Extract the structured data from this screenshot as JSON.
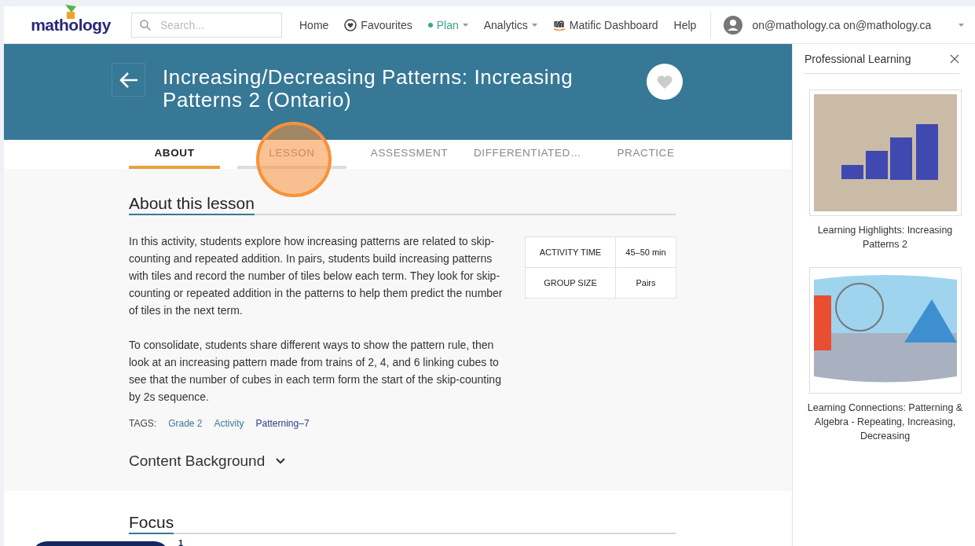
{
  "logo": {
    "text": "mathology"
  },
  "search": {
    "placeholder": "Search..."
  },
  "nav": [
    {
      "label": "Home",
      "kind": "plain",
      "selected": false
    },
    {
      "label": "Favourites",
      "kind": "favourites",
      "selected": false
    },
    {
      "label": "Plan",
      "kind": "dropdown",
      "selected": true
    },
    {
      "label": "Analytics",
      "kind": "dropdown",
      "selected": false
    },
    {
      "label": "Matific Dashboard",
      "kind": "matific",
      "selected": false
    },
    {
      "label": "Help",
      "kind": "plain",
      "selected": false
    }
  ],
  "user": {
    "email": "on@mathology.ca on@mathology.ca"
  },
  "lesson": {
    "title": "Increasing/Decreasing Patterns: Increasing Patterns 2 (Ontario)"
  },
  "tabs": [
    {
      "label": "ABOUT",
      "selected": true,
      "spotlight": false
    },
    {
      "label": "LESSON",
      "selected": false,
      "spotlight": true
    },
    {
      "label": "ASSESSMENT",
      "selected": false,
      "spotlight": false
    },
    {
      "label": "DIFFERENTIATED…",
      "selected": false,
      "spotlight": false
    },
    {
      "label": "PRACTICE",
      "selected": false,
      "spotlight": false
    }
  ],
  "about": {
    "heading": "About this lesson",
    "paragraphs": [
      "In this activity, students explore how increasing patterns are related to skip-counting and repeated addition. In pairs, students build increasing patterns with tiles and record the number of tiles below each term. They look for skip-counting or repeated addition in the patterns to help them predict the number of tiles in the next term.",
      "To consolidate, students share different ways to show the pattern rule, then look at an increasing pattern made from trains of 2, 4, and 6 linking cubes to see that the number of cubes in each term form the start of the skip-counting by 2s sequence."
    ],
    "facts": [
      {
        "label": "ACTIVITY TIME",
        "value": "45–50 min"
      },
      {
        "label": "GROUP SIZE",
        "value": "Pairs"
      }
    ],
    "tags_label": "TAGS:",
    "tags": [
      {
        "label": "Grade 2",
        "color": "#3a7a96"
      },
      {
        "label": "Activity",
        "color": "#3a7a96"
      },
      {
        "label": "Patterning–7",
        "color": "#2c3e86"
      }
    ],
    "content_background": {
      "label": "Content Background",
      "expanded": false
    }
  },
  "focus": {
    "heading": "Focus"
  },
  "launcher": {
    "badge": "1"
  },
  "sidebar": {
    "title": "Professional Learning",
    "items": [
      {
        "kind": "tiles",
        "caption": "Learning Highlights: Increasing Patterns 2"
      },
      {
        "kind": "illustration",
        "caption": "Learning Connections: Patterning & Algebra - Repeating, Increasing, Decreasing"
      }
    ]
  }
}
